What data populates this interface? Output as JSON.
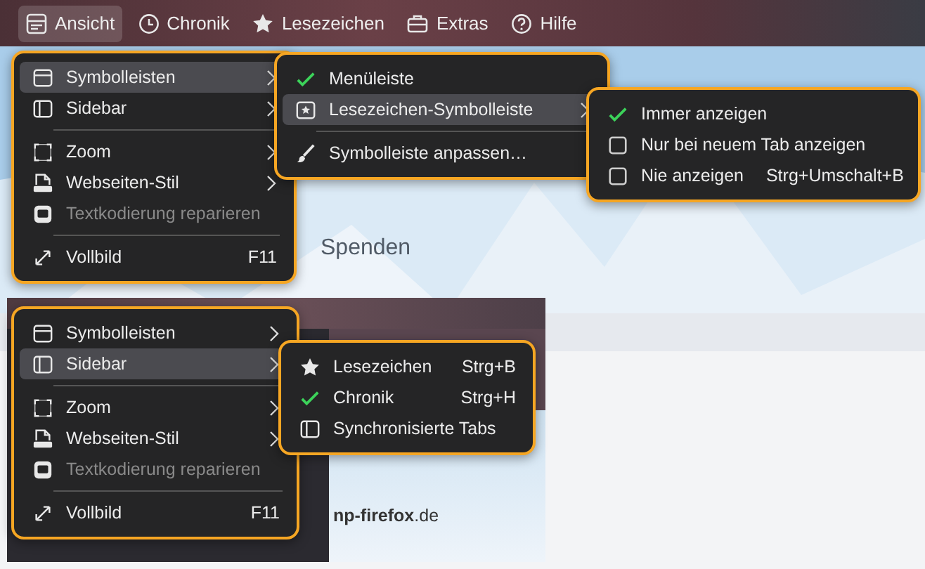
{
  "menubar": [
    {
      "label": "Ansicht",
      "selected": true
    },
    {
      "label": "Chronik",
      "selected": false
    },
    {
      "label": "Lesezeichen",
      "selected": false
    },
    {
      "label": "Extras",
      "selected": false
    },
    {
      "label": "Hilfe",
      "selected": false
    }
  ],
  "page": {
    "heading": "Spenden"
  },
  "menus": [
    {
      "items": [
        {
          "kind": "submenu",
          "label": "Symbolleisten",
          "selected": true,
          "disabled": false
        },
        {
          "kind": "submenu",
          "label": "Sidebar",
          "selected": false,
          "disabled": false
        },
        {
          "kind": "separator"
        },
        {
          "kind": "submenu",
          "label": "Zoom",
          "selected": false,
          "disabled": false
        },
        {
          "kind": "submenu",
          "label": "Webseiten-Stil",
          "selected": false,
          "disabled": false
        },
        {
          "kind": "item",
          "label": "Textkodierung reparieren",
          "selected": false,
          "disabled": true
        },
        {
          "kind": "separator"
        },
        {
          "kind": "item",
          "label": "Vollbild",
          "shortcut": "F11",
          "selected": false,
          "disabled": false
        }
      ]
    },
    {
      "items": [
        {
          "kind": "toggle",
          "label": "Menüleiste",
          "checked": true,
          "selected": false,
          "disabled": false
        },
        {
          "kind": "submenu",
          "label": "Lesezeichen-Symbolleiste",
          "selected": true,
          "disabled": false
        },
        {
          "kind": "separator"
        },
        {
          "kind": "item",
          "label": "Symbolleiste anpassen…",
          "selected": false,
          "disabled": false
        }
      ]
    },
    {
      "items": [
        {
          "kind": "option",
          "label": "Immer anzeigen",
          "checked": true,
          "selected": false,
          "disabled": false
        },
        {
          "kind": "option",
          "label": "Nur bei neuem Tab anzeigen",
          "checked": false,
          "selected": false,
          "disabled": false
        },
        {
          "kind": "option",
          "label": "Nie anzeigen",
          "shortcut": "Strg+Umschalt+B",
          "checked": false,
          "selected": false,
          "disabled": false
        }
      ]
    }
  ],
  "inset": {
    "site": "**np-firefox**.de",
    "menus": [
      {
        "items": [
          {
            "kind": "submenu",
            "label": "Symbolleisten",
            "selected": false,
            "disabled": false
          },
          {
            "kind": "submenu",
            "label": "Sidebar",
            "selected": true,
            "disabled": false
          },
          {
            "kind": "separator"
          },
          {
            "kind": "submenu",
            "label": "Zoom",
            "selected": false,
            "disabled": false
          },
          {
            "kind": "submenu",
            "label": "Webseiten-Stil",
            "selected": false,
            "disabled": false
          },
          {
            "kind": "item",
            "label": "Textkodierung reparieren",
            "selected": false,
            "disabled": true
          },
          {
            "kind": "separator"
          },
          {
            "kind": "item",
            "label": "Vollbild",
            "shortcut": "F11",
            "selected": false,
            "disabled": false
          }
        ]
      },
      {
        "items": [
          {
            "kind": "toggle",
            "label": "Lesezeichen",
            "shortcut": "Strg+B",
            "checked": false,
            "selected": false,
            "disabled": false
          },
          {
            "kind": "toggle",
            "label": "Chronik",
            "shortcut": "Strg+H",
            "checked": true,
            "selected": false,
            "disabled": false
          },
          {
            "kind": "toggle",
            "label": "Synchronisierte Tabs",
            "checked": false,
            "selected": false,
            "disabled": false
          }
        ]
      }
    ]
  }
}
